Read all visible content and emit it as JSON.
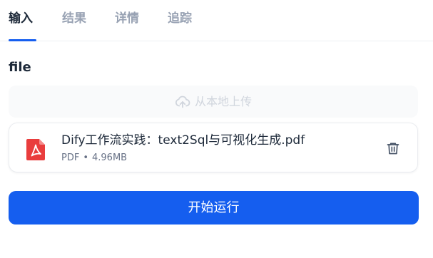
{
  "tabs": [
    {
      "label": "输入",
      "active": true
    },
    {
      "label": "结果",
      "active": false
    },
    {
      "label": "详情",
      "active": false
    },
    {
      "label": "追踪",
      "active": false
    }
  ],
  "input": {
    "field_label": "file",
    "upload_label": "从本地上传",
    "upload_icon": "cloud-upload-icon"
  },
  "file": {
    "name": "Dify工作流实践：text2Sql与可视化生成.pdf",
    "type": "PDF",
    "separator": "•",
    "size": "4.96MB",
    "icon": "pdf-file-icon",
    "delete_icon": "trash-icon"
  },
  "actions": {
    "run_label": "开始运行"
  },
  "colors": {
    "accent": "#155eef",
    "pdf_red": "#e93d3d",
    "text_primary": "#1d2939",
    "text_muted": "#98a2b3"
  }
}
